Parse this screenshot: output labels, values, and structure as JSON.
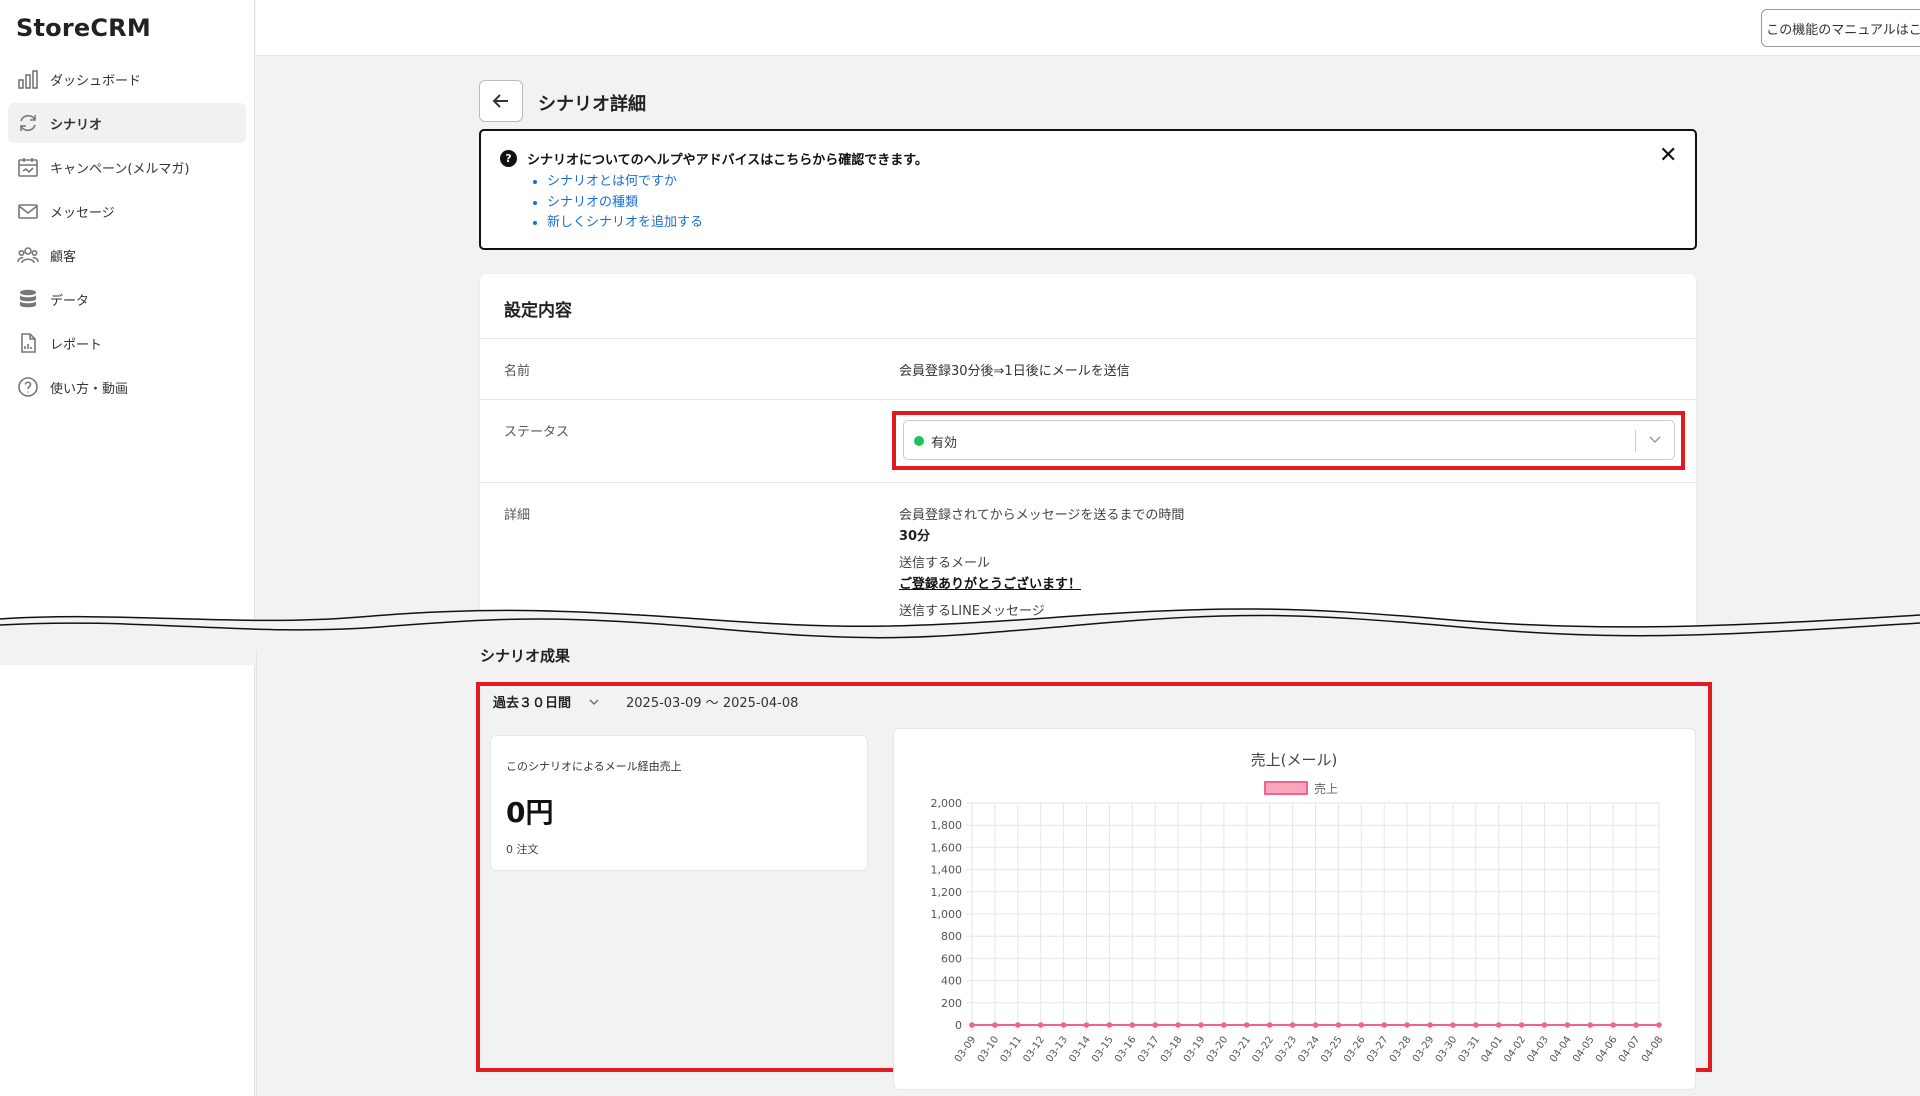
{
  "app": {
    "name": "StoreCRM"
  },
  "sidebar": {
    "items": [
      {
        "label": "ダッシュボード",
        "icon": "bar-chart-icon",
        "active": false
      },
      {
        "label": "シナリオ",
        "icon": "refresh-icon",
        "active": true
      },
      {
        "label": "キャンペーン(メルマガ)",
        "icon": "calendar-icon",
        "active": false
      },
      {
        "label": "メッセージ",
        "icon": "mail-icon",
        "active": false
      },
      {
        "label": "顧客",
        "icon": "users-icon",
        "active": false
      },
      {
        "label": "データ",
        "icon": "database-icon",
        "active": false
      },
      {
        "label": "レポート",
        "icon": "report-file-icon",
        "active": false
      },
      {
        "label": "使い方・動画",
        "icon": "help-circle-icon",
        "active": false
      }
    ]
  },
  "topbar": {
    "manual_button": "この機能のマニュアルはこちら"
  },
  "page": {
    "title": "シナリオ詳細"
  },
  "help": {
    "text": "シナリオについてのヘルプやアドバイスはこちらから確認できます。",
    "links": [
      "シナリオとは何ですか",
      "シナリオの種類",
      "新しくシナリオを追加する"
    ]
  },
  "settings": {
    "title": "設定内容",
    "name_label": "名前",
    "name_value": "会員登録30分後⇒1日後にメールを送信",
    "status_label": "ステータス",
    "status_value": "有効",
    "status_color": "#21c25e",
    "detail_label": "詳細",
    "detail_time_label": "会員登録されてからメッセージを送るまでの時間",
    "detail_time_value": "30分",
    "detail_mail_label": "送信するメール",
    "detail_mail_value": "ご登録ありがとうございます！",
    "detail_line_label": "送信するLINEメッセージ"
  },
  "results": {
    "title": "シナリオ成果",
    "range_label": "過去３０日間",
    "range_dates": "2025-03-09 〜 2025-04-08",
    "stat_label": "このシナリオによるメール経由売上",
    "stat_value": "0円",
    "stat_orders": "0 注文"
  },
  "colors": {
    "highlight": "#e21b23",
    "link": "#1a6fd0",
    "series": "#f0648c"
  },
  "chart_data": {
    "type": "line",
    "title": "売上(メール)",
    "series": [
      {
        "name": "売上",
        "values": [
          0,
          0,
          0,
          0,
          0,
          0,
          0,
          0,
          0,
          0,
          0,
          0,
          0,
          0,
          0,
          0,
          0,
          0,
          0,
          0,
          0,
          0,
          0,
          0,
          0,
          0,
          0,
          0,
          0,
          0,
          0,
          0
        ]
      }
    ],
    "categories": [
      "03-09",
      "03-10",
      "03-11",
      "03-12",
      "03-13",
      "03-14",
      "03-15",
      "03-16",
      "03-17",
      "03-18",
      "03-19",
      "03-20",
      "03-21",
      "03-22",
      "03-23",
      "03-24",
      "03-25",
      "03-26",
      "03-27",
      "03-28",
      "03-29",
      "03-30",
      "03-31",
      "04-01",
      "04-02",
      "04-03",
      "04-04",
      "04-05",
      "04-06",
      "04-07",
      "04-08"
    ],
    "yticks": [
      "0",
      "200",
      "400",
      "600",
      "800",
      "1,000",
      "1,200",
      "1,400",
      "1,600",
      "1,800",
      "2,000"
    ],
    "ylim": [
      0,
      2000
    ],
    "grid": true,
    "legend": "top-center"
  }
}
